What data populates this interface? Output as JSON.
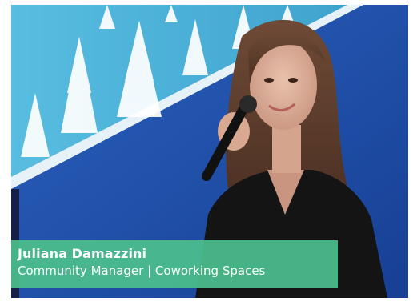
{
  "photo": {
    "subject": "speaker-photo",
    "background_color": "#1f4fa8",
    "banner_color": "#4bb0d6"
  },
  "caption": {
    "name": "Juliana  Damazzini",
    "role": "Community Manager  |  Coworking Spaces",
    "background_color": "#4bbe8c"
  }
}
